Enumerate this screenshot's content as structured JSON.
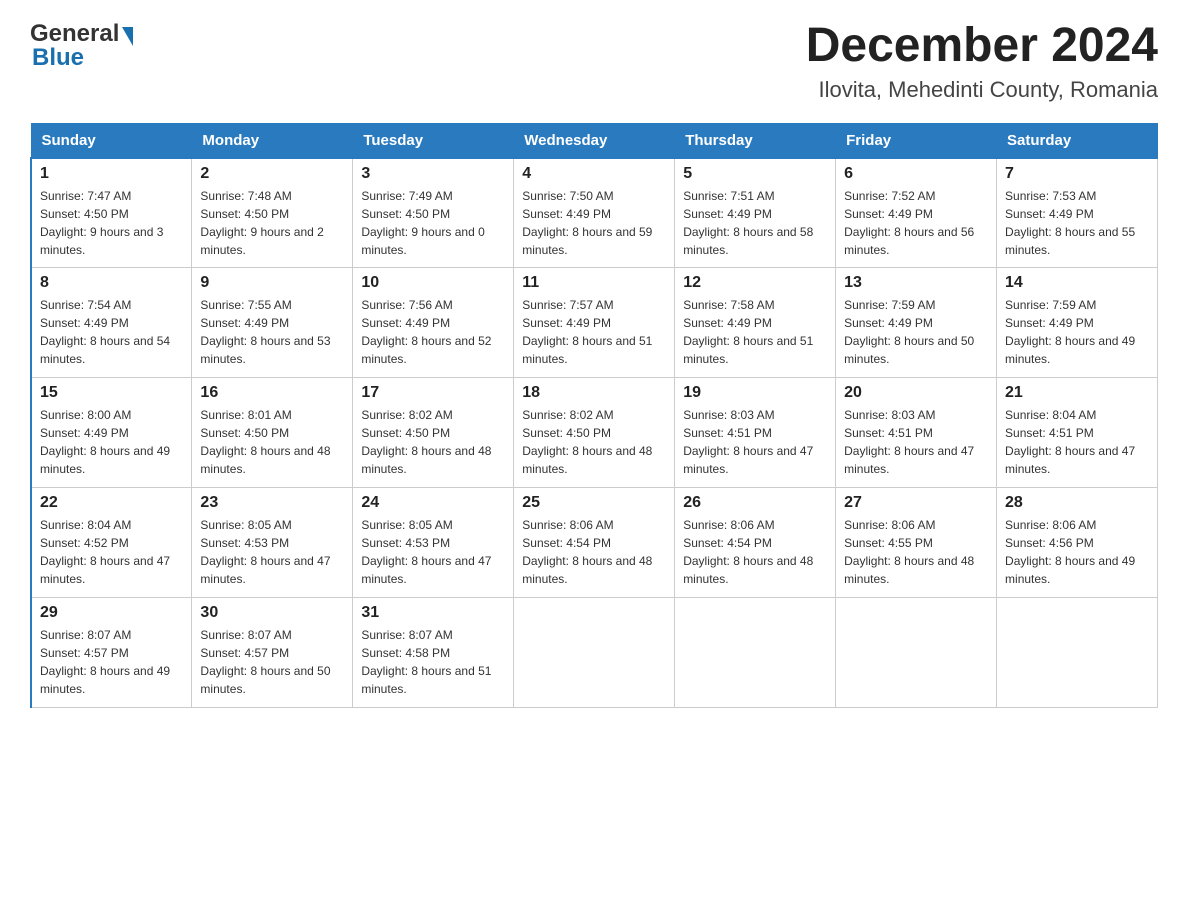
{
  "header": {
    "logo_general": "General",
    "logo_blue": "Blue",
    "month_year": "December 2024",
    "location": "Ilovita, Mehedinti County, Romania"
  },
  "days_of_week": [
    "Sunday",
    "Monday",
    "Tuesday",
    "Wednesday",
    "Thursday",
    "Friday",
    "Saturday"
  ],
  "weeks": [
    [
      {
        "day": "1",
        "sunrise": "7:47 AM",
        "sunset": "4:50 PM",
        "daylight": "9 hours and 3 minutes."
      },
      {
        "day": "2",
        "sunrise": "7:48 AM",
        "sunset": "4:50 PM",
        "daylight": "9 hours and 2 minutes."
      },
      {
        "day": "3",
        "sunrise": "7:49 AM",
        "sunset": "4:50 PM",
        "daylight": "9 hours and 0 minutes."
      },
      {
        "day": "4",
        "sunrise": "7:50 AM",
        "sunset": "4:49 PM",
        "daylight": "8 hours and 59 minutes."
      },
      {
        "day": "5",
        "sunrise": "7:51 AM",
        "sunset": "4:49 PM",
        "daylight": "8 hours and 58 minutes."
      },
      {
        "day": "6",
        "sunrise": "7:52 AM",
        "sunset": "4:49 PM",
        "daylight": "8 hours and 56 minutes."
      },
      {
        "day": "7",
        "sunrise": "7:53 AM",
        "sunset": "4:49 PM",
        "daylight": "8 hours and 55 minutes."
      }
    ],
    [
      {
        "day": "8",
        "sunrise": "7:54 AM",
        "sunset": "4:49 PM",
        "daylight": "8 hours and 54 minutes."
      },
      {
        "day": "9",
        "sunrise": "7:55 AM",
        "sunset": "4:49 PM",
        "daylight": "8 hours and 53 minutes."
      },
      {
        "day": "10",
        "sunrise": "7:56 AM",
        "sunset": "4:49 PM",
        "daylight": "8 hours and 52 minutes."
      },
      {
        "day": "11",
        "sunrise": "7:57 AM",
        "sunset": "4:49 PM",
        "daylight": "8 hours and 51 minutes."
      },
      {
        "day": "12",
        "sunrise": "7:58 AM",
        "sunset": "4:49 PM",
        "daylight": "8 hours and 51 minutes."
      },
      {
        "day": "13",
        "sunrise": "7:59 AM",
        "sunset": "4:49 PM",
        "daylight": "8 hours and 50 minutes."
      },
      {
        "day": "14",
        "sunrise": "7:59 AM",
        "sunset": "4:49 PM",
        "daylight": "8 hours and 49 minutes."
      }
    ],
    [
      {
        "day": "15",
        "sunrise": "8:00 AM",
        "sunset": "4:49 PM",
        "daylight": "8 hours and 49 minutes."
      },
      {
        "day": "16",
        "sunrise": "8:01 AM",
        "sunset": "4:50 PM",
        "daylight": "8 hours and 48 minutes."
      },
      {
        "day": "17",
        "sunrise": "8:02 AM",
        "sunset": "4:50 PM",
        "daylight": "8 hours and 48 minutes."
      },
      {
        "day": "18",
        "sunrise": "8:02 AM",
        "sunset": "4:50 PM",
        "daylight": "8 hours and 48 minutes."
      },
      {
        "day": "19",
        "sunrise": "8:03 AM",
        "sunset": "4:51 PM",
        "daylight": "8 hours and 47 minutes."
      },
      {
        "day": "20",
        "sunrise": "8:03 AM",
        "sunset": "4:51 PM",
        "daylight": "8 hours and 47 minutes."
      },
      {
        "day": "21",
        "sunrise": "8:04 AM",
        "sunset": "4:51 PM",
        "daylight": "8 hours and 47 minutes."
      }
    ],
    [
      {
        "day": "22",
        "sunrise": "8:04 AM",
        "sunset": "4:52 PM",
        "daylight": "8 hours and 47 minutes."
      },
      {
        "day": "23",
        "sunrise": "8:05 AM",
        "sunset": "4:53 PM",
        "daylight": "8 hours and 47 minutes."
      },
      {
        "day": "24",
        "sunrise": "8:05 AM",
        "sunset": "4:53 PM",
        "daylight": "8 hours and 47 minutes."
      },
      {
        "day": "25",
        "sunrise": "8:06 AM",
        "sunset": "4:54 PM",
        "daylight": "8 hours and 48 minutes."
      },
      {
        "day": "26",
        "sunrise": "8:06 AM",
        "sunset": "4:54 PM",
        "daylight": "8 hours and 48 minutes."
      },
      {
        "day": "27",
        "sunrise": "8:06 AM",
        "sunset": "4:55 PM",
        "daylight": "8 hours and 48 minutes."
      },
      {
        "day": "28",
        "sunrise": "8:06 AM",
        "sunset": "4:56 PM",
        "daylight": "8 hours and 49 minutes."
      }
    ],
    [
      {
        "day": "29",
        "sunrise": "8:07 AM",
        "sunset": "4:57 PM",
        "daylight": "8 hours and 49 minutes."
      },
      {
        "day": "30",
        "sunrise": "8:07 AM",
        "sunset": "4:57 PM",
        "daylight": "8 hours and 50 minutes."
      },
      {
        "day": "31",
        "sunrise": "8:07 AM",
        "sunset": "4:58 PM",
        "daylight": "8 hours and 51 minutes."
      },
      null,
      null,
      null,
      null
    ]
  ],
  "labels": {
    "sunrise": "Sunrise:",
    "sunset": "Sunset:",
    "daylight": "Daylight:"
  }
}
